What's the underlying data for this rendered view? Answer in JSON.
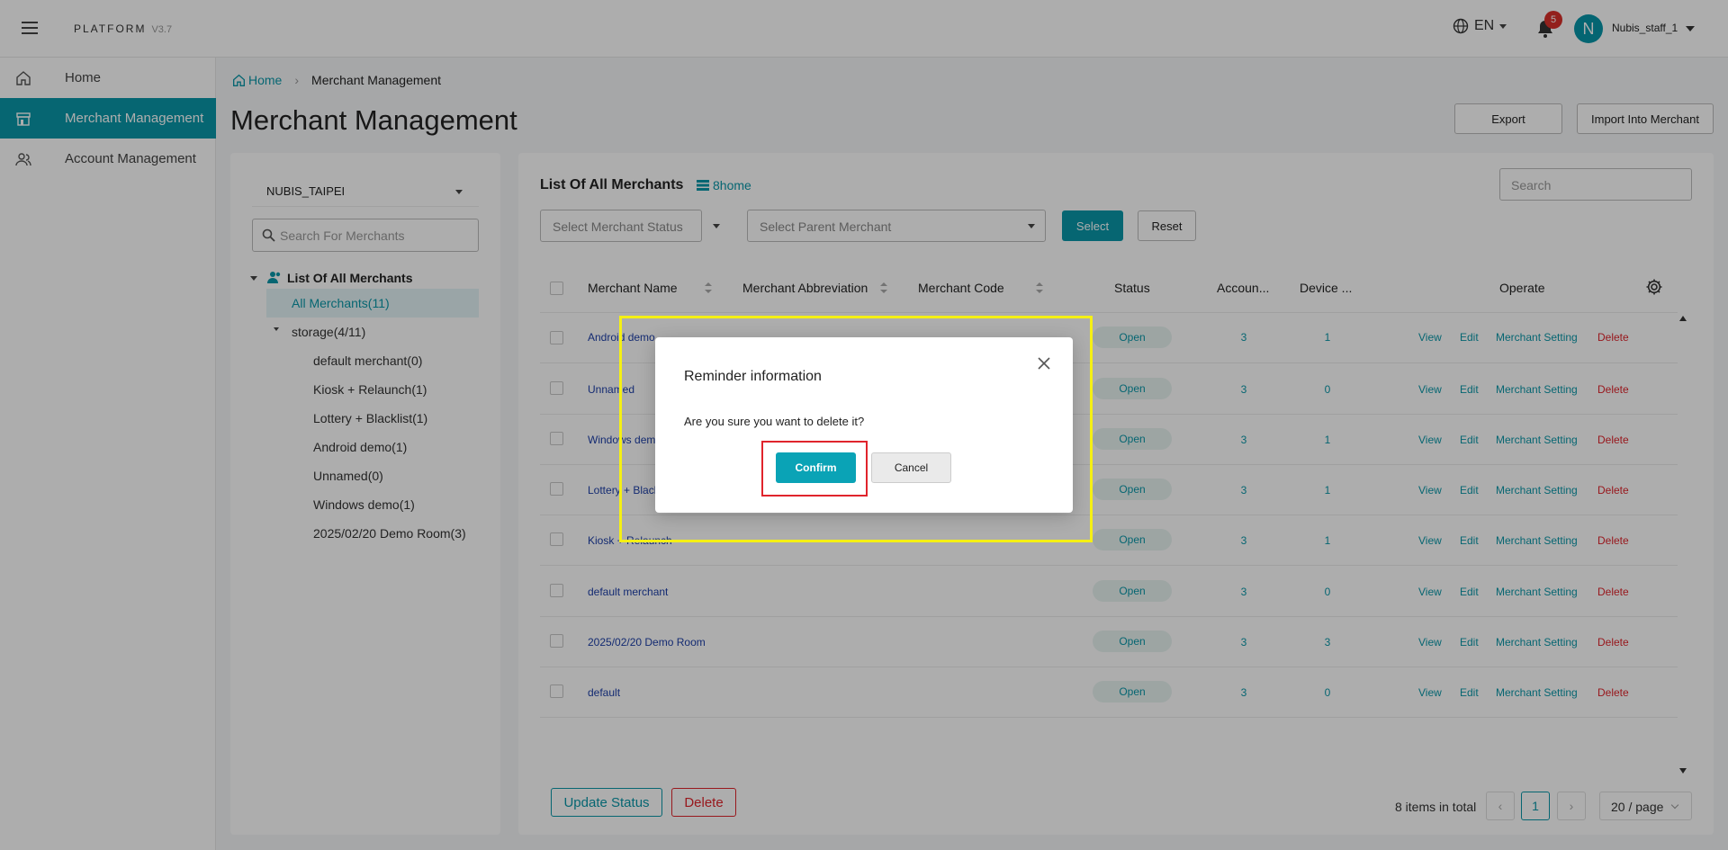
{
  "header": {
    "brand": "PLATFORM",
    "version": "V3.7",
    "language": "EN",
    "notification_count": "5",
    "avatar_initial": "N",
    "username": "Nubis_staff_1"
  },
  "sidebar": {
    "items": [
      {
        "label": "Home",
        "icon": "home-icon"
      },
      {
        "label": "Merchant Management",
        "icon": "store-icon"
      },
      {
        "label": "Account Management",
        "icon": "users-icon"
      }
    ]
  },
  "breadcrumb": {
    "home": "Home",
    "current": "Merchant Management"
  },
  "page": {
    "title": "Merchant Management",
    "export_label": "Export",
    "import_label": "Import Into Merchant"
  },
  "left_panel": {
    "org_select": "NUBIS_TAIPEI",
    "search_placeholder": "Search For Merchants",
    "tree_root": "List Of All Merchants",
    "all_merchants": "All Merchants(11)",
    "storage": "storage(4/11)",
    "children": [
      "default merchant(0)",
      "Kiosk + Relaunch(1)",
      "Lottery + Blacklist(1)",
      "Android demo(1)",
      "Unnamed(0)",
      "Windows demo(1)",
      "2025/02/20 Demo Room(3)"
    ]
  },
  "list": {
    "title": "List Of All Merchants",
    "home_link": "8home",
    "search_placeholder": "Search",
    "status_filter_placeholder": "Select Merchant Status",
    "parent_filter_placeholder": "Select Parent Merchant",
    "select_label": "Select",
    "reset_label": "Reset",
    "columns": [
      "Merchant Name",
      "Merchant Abbreviation",
      "Merchant Code",
      "Status",
      "Accoun...",
      "Device ...",
      "Operate"
    ],
    "rows": [
      {
        "name": "Android demo",
        "status": "Open",
        "accounts": "3",
        "devices": "1"
      },
      {
        "name": "Unnamed",
        "status": "Open",
        "accounts": "3",
        "devices": "0"
      },
      {
        "name": "Windows demo",
        "status": "Open",
        "accounts": "3",
        "devices": "1"
      },
      {
        "name": "Lottery + Blacklist",
        "status": "Open",
        "accounts": "3",
        "devices": "1"
      },
      {
        "name": "Kiosk + Relaunch",
        "status": "Open",
        "accounts": "3",
        "devices": "1"
      },
      {
        "name": "default merchant",
        "status": "Open",
        "accounts": "3",
        "devices": "0"
      },
      {
        "name": "2025/02/20 Demo Room",
        "status": "Open",
        "accounts": "3",
        "devices": "3"
      },
      {
        "name": "default",
        "status": "Open",
        "accounts": "3",
        "devices": "0"
      }
    ],
    "ops": {
      "view": "View",
      "edit": "Edit",
      "setting": "Merchant Setting",
      "delete": "Delete"
    },
    "update_status_label": "Update Status",
    "delete_label": "Delete",
    "total": "8 items in total",
    "current_page": "1",
    "per_page": "20 / page"
  },
  "dialog": {
    "title": "Reminder information",
    "message": "Are you sure you want to delete it?",
    "confirm_label": "Confirm",
    "cancel_label": "Cancel"
  },
  "colors": {
    "accent": "#0a97a8",
    "danger": "#e0242c",
    "highlight_yellow": "#f5f014"
  }
}
